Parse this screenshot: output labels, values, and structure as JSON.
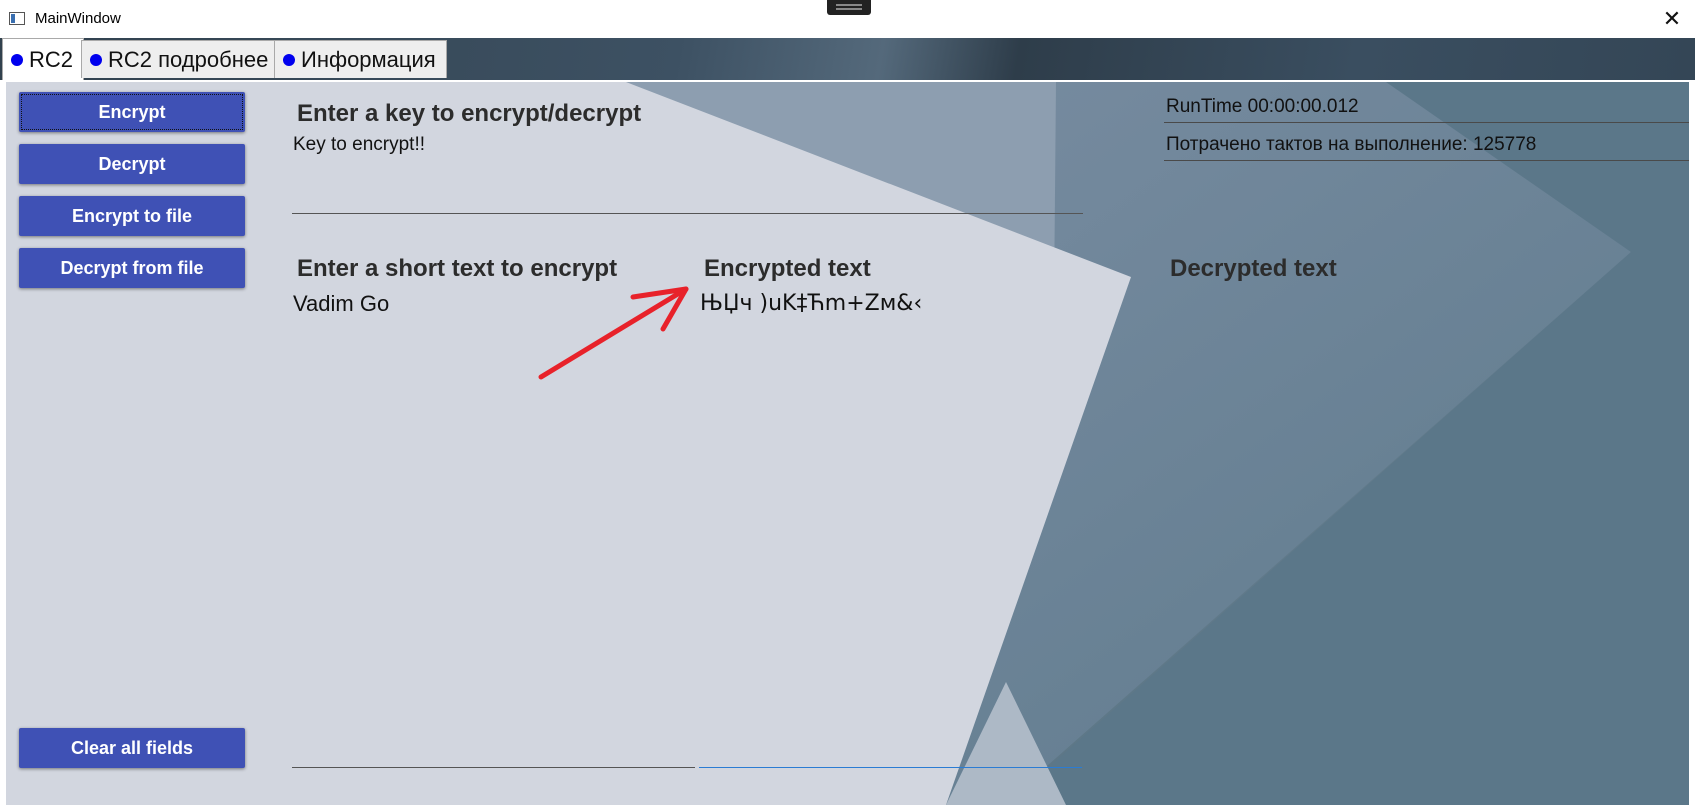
{
  "window": {
    "title": "MainWindow",
    "close_glyph": "✕"
  },
  "tabs": [
    {
      "label": "RC2",
      "active": true
    },
    {
      "label": "RC2 подробнее",
      "active": false
    },
    {
      "label": "Информация",
      "active": false
    }
  ],
  "sidebar": {
    "encrypt_label": "Encrypt",
    "decrypt_label": "Decrypt",
    "encrypt_file_label": "Encrypt to file",
    "decrypt_file_label": "Decrypt from file",
    "clear_label": "Clear all fields",
    "button_color": "#3f51b5"
  },
  "key_section": {
    "heading": "Enter a key to encrypt/decrypt",
    "value": "Key to encrypt!!"
  },
  "plain_section": {
    "heading": "Enter a short text to encrypt",
    "value": "Vadim Go"
  },
  "encrypted_section": {
    "heading": "Encrypted text",
    "value": "ЊЏч )uK‡Ћm+Zм&‹"
  },
  "decrypted_section": {
    "heading": "Decrypted text",
    "value": ""
  },
  "stats": {
    "runtime": "RunTime 00:00:00.012",
    "ticks": "Потрачено тактов на выполнение: 125778"
  },
  "annotation": {
    "type": "arrow-icon",
    "color": "#e8222a"
  }
}
